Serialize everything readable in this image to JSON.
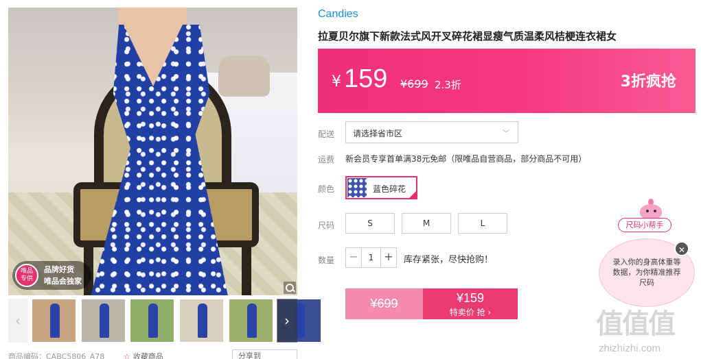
{
  "gallery": {
    "badge": {
      "circle_text": "唯品\n专供",
      "line1": "品牌好货",
      "line2": "唯品会独家"
    },
    "prev_glyph": "‹",
    "next_glyph": "›"
  },
  "meta": {
    "sku": "商品编码：CABC5806_A78",
    "favorite": "收藏商品",
    "share": "分享到"
  },
  "product": {
    "brand": "Candies",
    "title": "拉夏贝尔旗下新款法式风开叉碎花裙显瘦气质温柔风桔梗连衣裙女"
  },
  "price": {
    "currency": "¥",
    "current": "159",
    "original": "¥699",
    "discount": "2.3折",
    "promo": "3折疯抢"
  },
  "labels": {
    "ship": "配送",
    "fee": "运费",
    "color": "颜色",
    "size": "尺码",
    "qty": "数量"
  },
  "shipping": {
    "region_placeholder": "请选择省市区",
    "fee_text": "新会员专享首单满38元免邮（限唯品自营商品，部分商品不可用）"
  },
  "color": {
    "selected": "蓝色碎花"
  },
  "sizes": [
    "S",
    "M",
    "L"
  ],
  "quantity": {
    "value": "1",
    "minus": "−",
    "plus": "+",
    "stock_text": "库存紧张，尽快抢购！"
  },
  "buy": {
    "original": "¥699",
    "price": "¥159",
    "label": "特卖价 抢 ›"
  },
  "size_helper": {
    "tag": "尺码小帮手",
    "text": "录入你的身高体重等数据，为你精准推荐尺码",
    "close": "✕"
  },
  "watermark": {
    "glyphs": "值值值",
    "url": "zhizhizhi.com"
  },
  "colors": {
    "accent": "#e5326f",
    "brand_blue": "#1d8fde"
  }
}
